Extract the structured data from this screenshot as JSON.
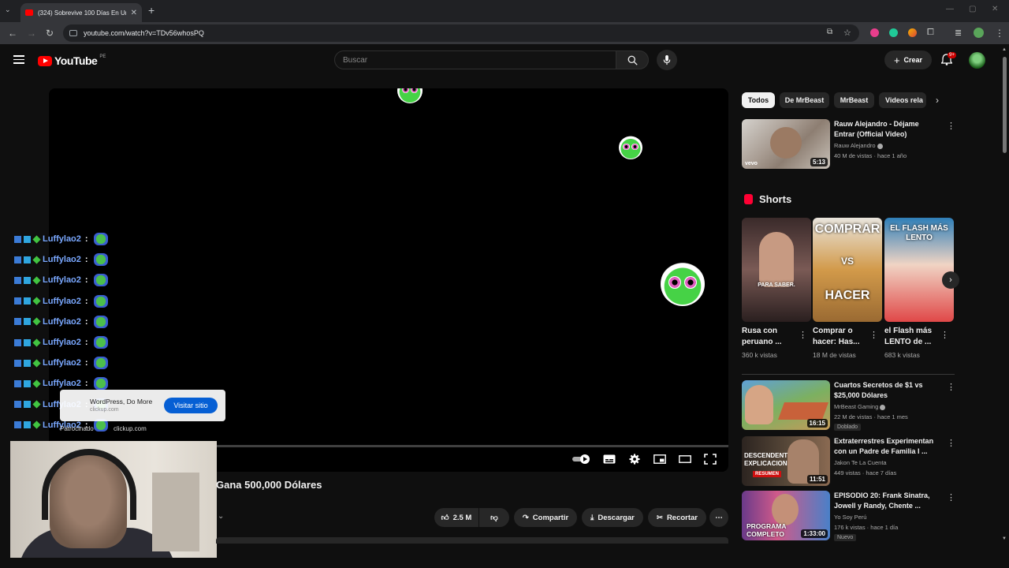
{
  "browser": {
    "tab_title": "(324) Sobrevive 100 Días En Un...",
    "url": "youtube.com/watch?v=TDv56whosPQ"
  },
  "header": {
    "logo_text": "YouTube",
    "country_code": "PE",
    "search_placeholder": "Buscar",
    "create_label": "Crear",
    "notifications_badge": "9+"
  },
  "chat": {
    "username": "Luffylao2",
    "separator": ":",
    "row_count": 10
  },
  "ad": {
    "headline": "WordPress, Do More",
    "domain_top": "clickup.com",
    "cta": "Visitar sitio",
    "brand": "Patrocinado",
    "domain_bottom": "clickup.com"
  },
  "video": {
    "title": "Gana 500,000 Dólares",
    "likes": "2.5 M",
    "share_label": "Compartir",
    "download_label": "Descargar",
    "clip_label": "Recortar"
  },
  "chips": [
    "Todos",
    "De MrBeast",
    "MrBeast",
    "Videos rela"
  ],
  "recommendations": [
    {
      "title": "Rauw Alejandro - Déjame Entrar (Official Video)",
      "channel": "Rauw Alejandro",
      "meta": "40 M de vistas · hace 1 año",
      "duration": "5:13",
      "thumb_label": "vevo"
    },
    {
      "title": "Cuartos Secretos de $1 vs $25,000 Dólares",
      "channel": "MrBeast Gaming",
      "meta": "22 M de vistas · hace 1 mes",
      "duration": "16:15",
      "tag": "Doblado"
    },
    {
      "title": "Extraterrestres Experimentan con un Padre de Familia I ...",
      "channel": "Jakon Te La Cuenta",
      "meta": "449 vistas · hace 7 días",
      "duration": "11:51",
      "thumb_label": "DESCENDENT EXPLICACION",
      "thumb_badge": "RESUMEN"
    },
    {
      "title": "EPISODIO 20: Frank Sinatra, Jowell y Randy, Chente ...",
      "channel": "Yo Soy Perú",
      "meta": "176 k vistas · hace 1 día",
      "duration": "1:33:00",
      "tag": "Nuevo",
      "thumb_label": "PROGRAMA COMPLETO"
    }
  ],
  "shorts": {
    "heading": "Shorts",
    "items": [
      {
        "title": "Rusa con peruano ...",
        "views": "360 k vistas",
        "overlay": "PARA SABER."
      },
      {
        "title": "Comprar o hacer: Has...",
        "views": "18 M de vistas",
        "overlay_top": "COMPRAR",
        "overlay_mid": "VS",
        "overlay_bottom": "HACER"
      },
      {
        "title": "el Flash más LENTO de ...",
        "views": "683 k vistas",
        "overlay": "EL FLASH MÁS LENTO"
      }
    ]
  }
}
